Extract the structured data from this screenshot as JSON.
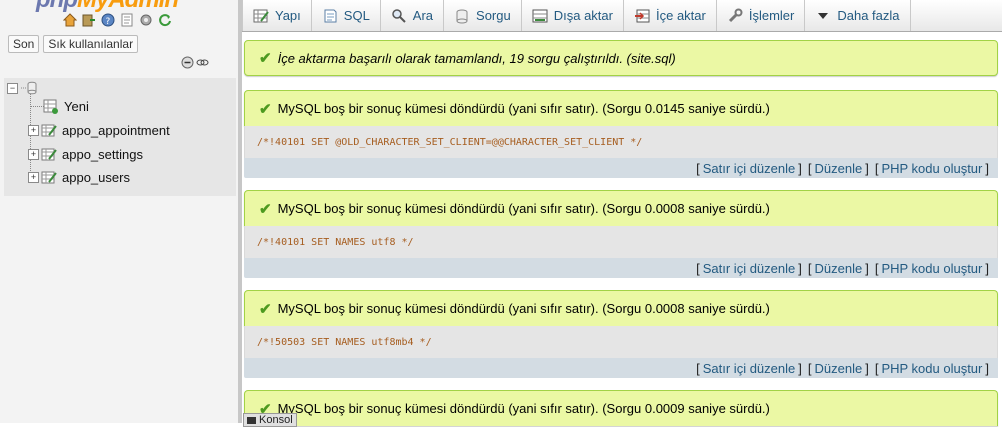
{
  "logo": {
    "left_text": "php",
    "right_text": "MyAdmin"
  },
  "sidebar": {
    "quick_icons": [
      "home-icon",
      "exit-icon",
      "help-icon",
      "docs-icon",
      "settings-icon",
      "reload-icon"
    ],
    "recent_tab": "Son",
    "favorites_tab": "Sık kullanılanlar",
    "tree": {
      "new_label": "Yeni",
      "tables": [
        "appo_appointment",
        "appo_settings",
        "appo_users"
      ]
    }
  },
  "menu": {
    "tabs": [
      {
        "label": "Yapı",
        "icon": "structure-icon"
      },
      {
        "label": "SQL",
        "icon": "sql-icon"
      },
      {
        "label": "Ara",
        "icon": "search-icon"
      },
      {
        "label": "Sorgu",
        "icon": "query-icon"
      },
      {
        "label": "Dışa aktar",
        "icon": "export-icon"
      },
      {
        "label": "İçe aktar",
        "icon": "import-icon"
      },
      {
        "label": "İşlemler",
        "icon": "wrench-icon"
      },
      {
        "label": "Daha fazla",
        "icon": "caret-down-icon"
      }
    ]
  },
  "main": {
    "import_message": "İçe aktarma başarılı olarak tamamlandı, 19 sorgu çalıştırıldı. (site.sql)",
    "results": [
      {
        "message": "MySQL boş bir sonuç kümesi döndürdü (yani sıfır satır). (Sorgu 0.0145 saniye sürdü.)",
        "sql": "/*!40101 SET @OLD_CHARACTER_SET_CLIENT=@@CHARACTER_SET_CLIENT */"
      },
      {
        "message": "MySQL boş bir sonuç kümesi döndürdü (yani sıfır satır). (Sorgu 0.0008 saniye sürdü.)",
        "sql": "/*!40101 SET NAMES utf8 */"
      },
      {
        "message": "MySQL boş bir sonuç kümesi döndürdü (yani sıfır satır). (Sorgu 0.0008 saniye sürdü.)",
        "sql": "/*!50503 SET NAMES utf8mb4 */"
      },
      {
        "message": "MySQL boş bir sonuç kümesi döndürdü (yani sıfır satır). (Sorgu 0.0009 saniye sürdü.)",
        "sql": ""
      }
    ],
    "tool_links": {
      "inline_edit": "Satır içi düzenle",
      "edit": "Düzenle",
      "php_code": "PHP kodu oluştur"
    }
  },
  "console_label": "Konsol",
  "colors": {
    "success_bg": "#ebf8a4",
    "success_border": "#a2d246",
    "link": "#235a81",
    "sql_text": "#a65d1f",
    "tools_bg": "#d3dce3"
  }
}
